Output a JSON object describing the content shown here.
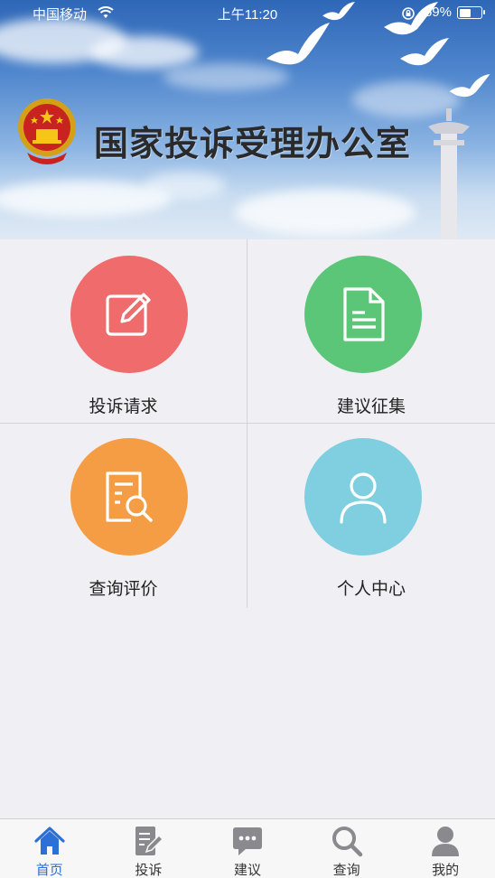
{
  "status_bar": {
    "carrier": "中国移动",
    "time": "上午11:20",
    "battery_percent": "59%",
    "battery_level": 0.59
  },
  "banner": {
    "title": "国家投诉受理办公室"
  },
  "menu": [
    {
      "label": "投诉请求",
      "icon": "edit-icon",
      "color": "#ef6b6c"
    },
    {
      "label": "建议征集",
      "icon": "document-icon",
      "color": "#5bc677"
    },
    {
      "label": "查询评价",
      "icon": "search-document-icon",
      "color": "#f49d45"
    },
    {
      "label": "个人中心",
      "icon": "person-icon",
      "color": "#7fcfe0"
    }
  ],
  "tabs": [
    {
      "label": "首页",
      "icon": "home-icon",
      "active": true
    },
    {
      "label": "投诉",
      "icon": "pencil-note-icon",
      "active": false
    },
    {
      "label": "建议",
      "icon": "chat-bubble-icon",
      "active": false
    },
    {
      "label": "查询",
      "icon": "search-icon",
      "active": false
    },
    {
      "label": "我的",
      "icon": "user-icon",
      "active": false
    }
  ],
  "colors": {
    "accent": "#2c6fd6",
    "tab_inactive_icon": "#8a8a8e"
  }
}
